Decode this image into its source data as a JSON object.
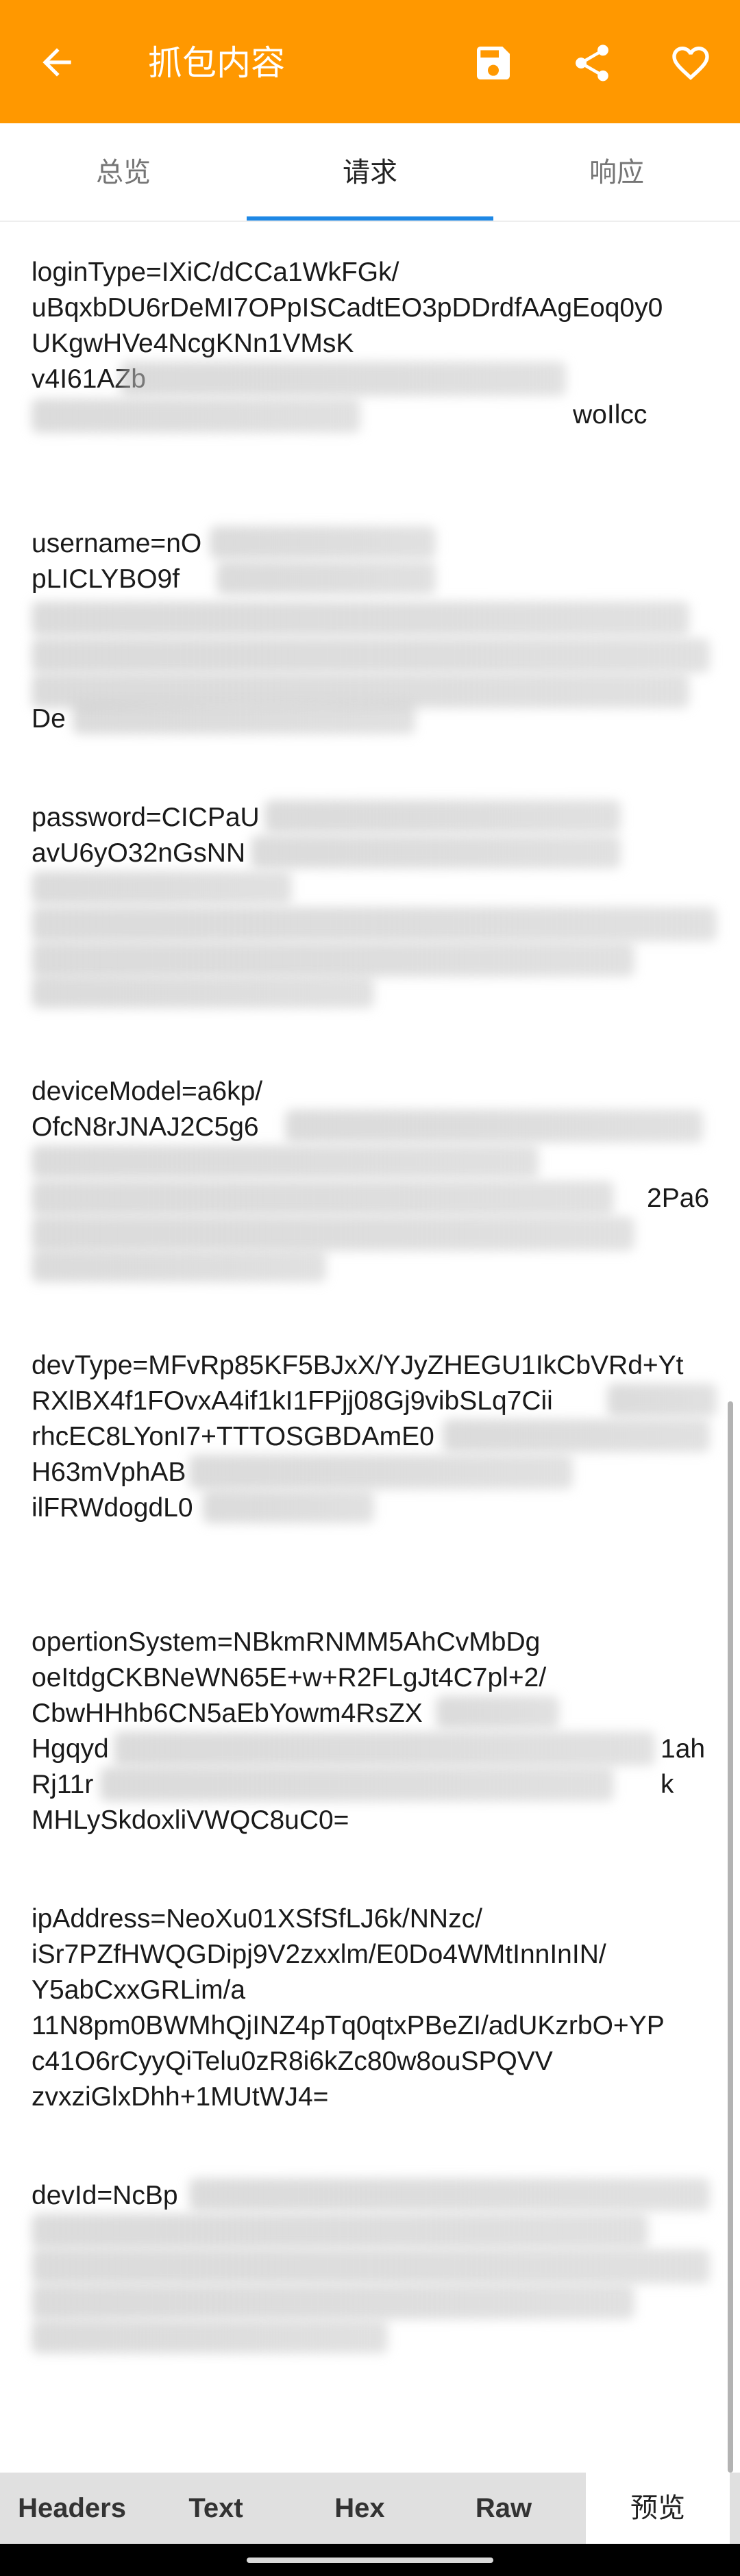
{
  "appbar": {
    "title": "抓包内容",
    "back_icon": "arrow-back-icon",
    "save_icon": "save-icon",
    "share_icon": "share-icon",
    "favorite_icon": "heart-icon",
    "color": "#FF9800"
  },
  "tabs": [
    {
      "label": "总览",
      "active": false
    },
    {
      "label": "请求",
      "active": true
    },
    {
      "label": "响应",
      "active": false
    }
  ],
  "params": [
    {
      "lines": [
        "loginType=IXiC/dCCa1WkFGk/",
        "uBqxbDU6rDeMI7OPpISCadtEO3pDDrdfAAgEoq0y0",
        "UKgwHVe4NcgKNn1VMsK",
        "v4I61AZb"
      ],
      "visible_tail": "woIlcc"
    },
    {
      "lines": [
        "username=nO",
        "pLICLYBO9f"
      ],
      "visible_tail": "De"
    },
    {
      "lines": [
        "password=CICPaU",
        "avU6yO32nGsNN"
      ],
      "visible_tail": ""
    },
    {
      "lines": [
        "deviceModel=a6kp/",
        "OfcN8rJNAJ2C5g6"
      ],
      "visible_tail": "2Pa6"
    },
    {
      "lines": [
        "devType=MFvRp85KF5BJxX/YJyZHEGU1IkCbVRd+Yt",
        "RXlBX4f1FOvxA4if1kI1FPjj08Gj9vibSLq7Cii",
        "rhcEC8LYonI7+TTTOSGBDAmE0",
        "H63mVphAB",
        "ilFRWdogdL0"
      ],
      "visible_tail": ""
    },
    {
      "lines": [
        "opertionSystem=NBkmRNMM5AhCvMbDg",
        "oeItdgCKBNeWN65E+w+R2FLgJt4C7pl+2/",
        "CbwHHhb6CN5aEbYowm4RsZX",
        "Hgqyd",
        "Rj11r",
        "MHLySkdoxliVWQC8uC0="
      ],
      "visible_tail": "1ahk"
    },
    {
      "lines": [
        "ipAddress=NeoXu01XSfSfLJ6k/NNzc/",
        "iSr7PZfHWQGDipj9V2zxxlm/E0Do4WMtInnInIN/",
        "Y5abCxxGRLim/a",
        "11N8pm0BWMhQjINZ4pTq0qtxPBeZI/adUKzrbO+YP",
        "c41O6rCyyQiTelu0zR8i6kZc80w8ouSPQVV",
        "zvxziGlxDhh+1MUtWJ4="
      ],
      "visible_tail": ""
    },
    {
      "lines": [
        "devId=NcBp"
      ],
      "visible_tail": ""
    }
  ],
  "bottom_tabs": [
    {
      "label": "Headers"
    },
    {
      "label": "Text"
    },
    {
      "label": "Hex"
    },
    {
      "label": "Raw"
    },
    {
      "label": "预览",
      "active": true
    }
  ]
}
